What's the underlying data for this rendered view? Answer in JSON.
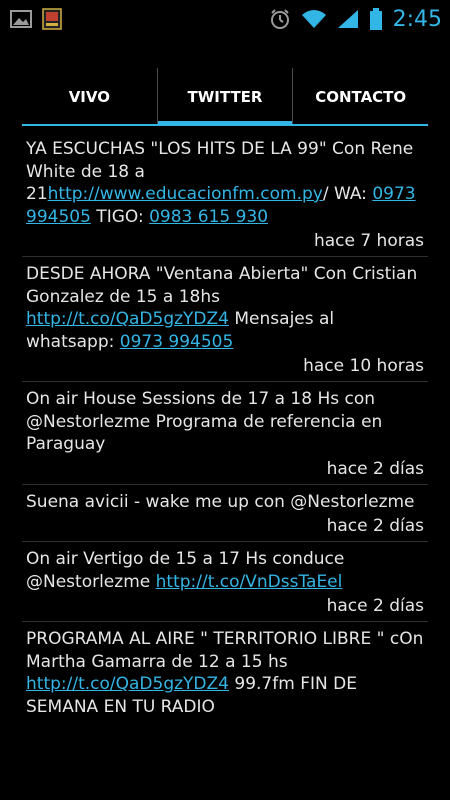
{
  "statusbar": {
    "time": "2:45",
    "icons": [
      "gallery-icon",
      "app-notification-icon",
      "alarm-icon",
      "wifi-icon",
      "signal-icon",
      "battery-icon"
    ]
  },
  "tabs": [
    {
      "label": "VIVO",
      "active": false
    },
    {
      "label": "TWITTER",
      "active": true
    },
    {
      "label": "CONTACTO",
      "active": false
    }
  ],
  "tweets": [
    {
      "t1": "YA ESCUCHAS \"LOS HITS DE LA 99\" Con Rene White de 18 a 21",
      "link1": "http://www.educacionfm.com.py",
      "t2": "/ WA: ",
      "link2": "0973 994505",
      "t3": " TIGO: ",
      "link3": "0983 615 930",
      "time": "hace 7 horas"
    },
    {
      "t1": "DESDE AHORA \"Ventana Abierta\" Con Cristian Gonzalez  de 15 a 18hs ",
      "link1": "http://t.co/QaD5gzYDZ4",
      "t2": "  Mensajes al whatsapp: ",
      "link2": "0973 994505",
      "time": "hace 10 horas"
    },
    {
      "t1": "On air House Sessions de 17 a 18 Hs  con @Nestorlezme Programa de referencia en Paraguay",
      "time": "hace 2 días"
    },
    {
      "t1": "Suena avicii - wake me up con @Nestorlezme",
      "time": "hace 2 días"
    },
    {
      "t1": "On air Vertigo de 15 a 17 Hs conduce @Nestorlezme ",
      "link1": "http://t.co/VnDssTaEel",
      "time": "hace 2 días"
    },
    {
      "t1": "PROGRAMA AL AIRE \" TERRITORIO LIBRE \" cOn Martha Gamarra de 12 a 15 hs ",
      "link1": "http://t.co/QaD5gzYDZ4",
      "t2": "  99.7fm FIN DE SEMANA EN TU RADIO",
      "time": ""
    }
  ]
}
